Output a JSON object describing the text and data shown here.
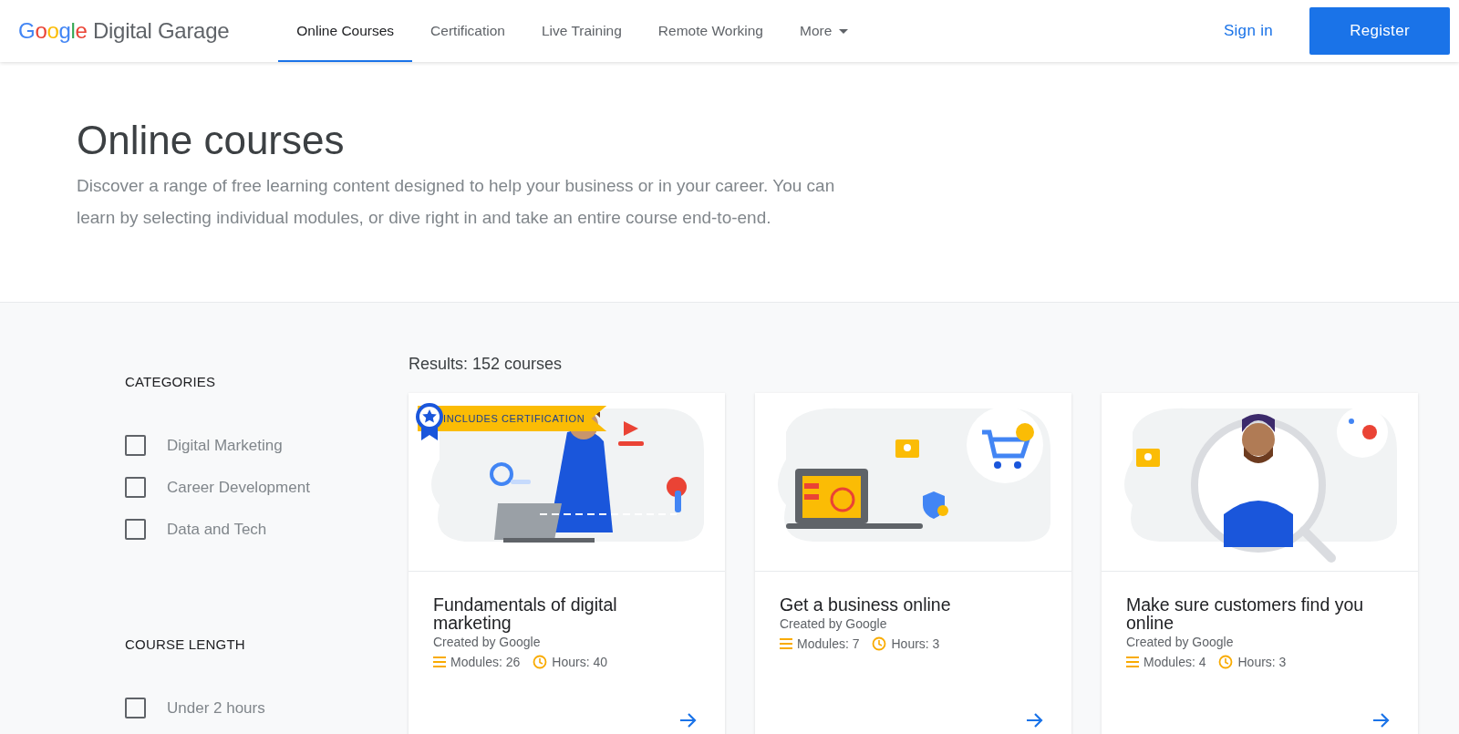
{
  "header": {
    "logo": {
      "brand": "Google",
      "product": "Digital Garage"
    },
    "nav": [
      {
        "label": "Online Courses",
        "selected": true,
        "dropdown": false
      },
      {
        "label": "Certification",
        "selected": false,
        "dropdown": false
      },
      {
        "label": "Live Training",
        "selected": false,
        "dropdown": false
      },
      {
        "label": "Remote Working",
        "selected": false,
        "dropdown": false
      },
      {
        "label": "More",
        "selected": false,
        "dropdown": true
      }
    ],
    "sign_in": "Sign in",
    "register": "Register"
  },
  "hero": {
    "title": "Online courses",
    "description": "Discover a range of free learning content designed to help your business or in your career. You can learn by selecting individual modules, or dive right in and take an entire course end-to-end."
  },
  "filters": [
    {
      "heading": "CATEGORIES",
      "options": [
        {
          "label": "Digital Marketing",
          "checked": false
        },
        {
          "label": "Career Development",
          "checked": false
        },
        {
          "label": "Data and Tech",
          "checked": false
        }
      ]
    },
    {
      "heading": "COURSE LENGTH",
      "options": [
        {
          "label": "Under 2 hours",
          "checked": false
        }
      ]
    }
  ],
  "results": {
    "summary": "Results: 152 courses",
    "courses": [
      {
        "kind": "laptop-person",
        "badge": "INCLUDES CERTIFICATION",
        "title": "Fundamentals of digital marketing",
        "creator": "Created by Google",
        "modules": "Modules: 26",
        "hours": "Hours: 40"
      },
      {
        "kind": "laptop-cart",
        "title": "Get a business online",
        "creator": "Created by Google",
        "modules": "Modules: 7",
        "hours": "Hours: 3"
      },
      {
        "kind": "magnifier-person",
        "title": "Make sure customers find you online",
        "creator": "Created by Google",
        "modules": "Modules: 4",
        "hours": "Hours: 3"
      }
    ]
  }
}
